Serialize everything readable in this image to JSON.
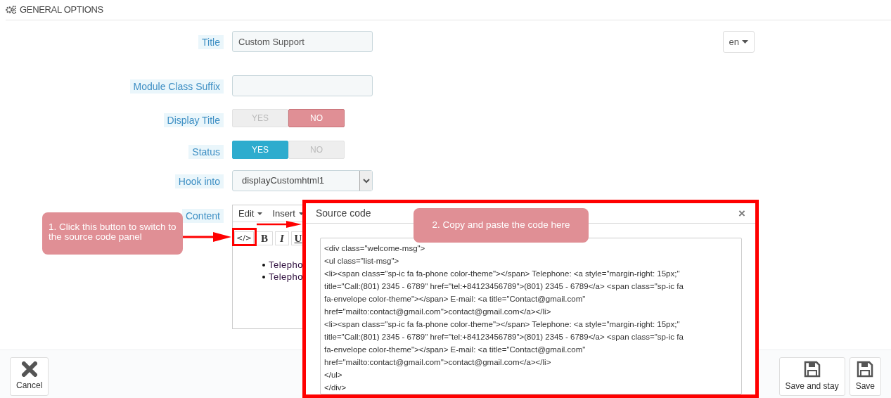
{
  "section_title": "GENERAL OPTIONS",
  "fields": [
    {
      "kind": "text",
      "label": "Title",
      "value": "Custom Support",
      "lang": "en"
    },
    {
      "kind": "text",
      "label": "Module Class Suffix"
    },
    {
      "kind": "toggle",
      "label": "Display Title",
      "options": [
        {
          "label": "YES",
          "selected": false
        },
        {
          "label": "NO",
          "selected": true
        }
      ]
    },
    {
      "kind": "toggle",
      "label": "Status",
      "options": [
        {
          "label": "YES",
          "selected": true
        },
        {
          "label": "NO",
          "selected": false
        }
      ]
    },
    {
      "kind": "select",
      "label": "Hook into",
      "value": "displayCustomhtml1"
    },
    {
      "kind": "editor",
      "label": "Content",
      "menus": [
        "Edit",
        "Insert"
      ],
      "tools": [
        "</>",
        "B",
        "I",
        "U"
      ],
      "items": [
        "Telepho",
        "Telepho"
      ]
    }
  ],
  "modal": {
    "title": "Source code",
    "close": "×",
    "code_lines": [
      "<div class=\"welcome-msg\">",
      "<ul class=\"list-msg\">",
      "<li><span class=\"sp-ic fa fa-phone color-theme\"></span> Telephone: <a style=\"margin-right: 15px;\"",
      "title=\"Call:(801) 2345 - 6789\" href=\"tel:+84123456789\">(801) 2345 - 6789</a> <span class=\"sp-ic fa",
      "fa-envelope color-theme\"></span> E-mail: <a title=\"Contact@gmail.com\"",
      "href=\"mailto:contact@gmail.com\">contact@gmail.com</a></li>",
      "<li><span class=\"sp-ic fa fa-phone color-theme\"></span> Telephone: <a style=\"margin-right: 15px;\"",
      "title=\"Call:(801) 2345 - 6789\" href=\"tel:+84123456789\">(801) 2345 - 6789</a> <span class=\"sp-ic fa",
      "fa-envelope color-theme\"></span> E-mail: <a title=\"Contact@gmail.com\"",
      "href=\"mailto:contact@gmail.com\">contact@gmail.com</a></li>",
      "</ul>",
      "</div>"
    ]
  },
  "callouts": [
    "1. Click this button to switch to the source code panel",
    "2. Copy and paste the code here"
  ],
  "footer_buttons": [
    {
      "kind": "cancel",
      "label": "Cancel"
    },
    {
      "kind": "save",
      "label": "Save and stay"
    },
    {
      "kind": "save",
      "label": "Save"
    }
  ]
}
